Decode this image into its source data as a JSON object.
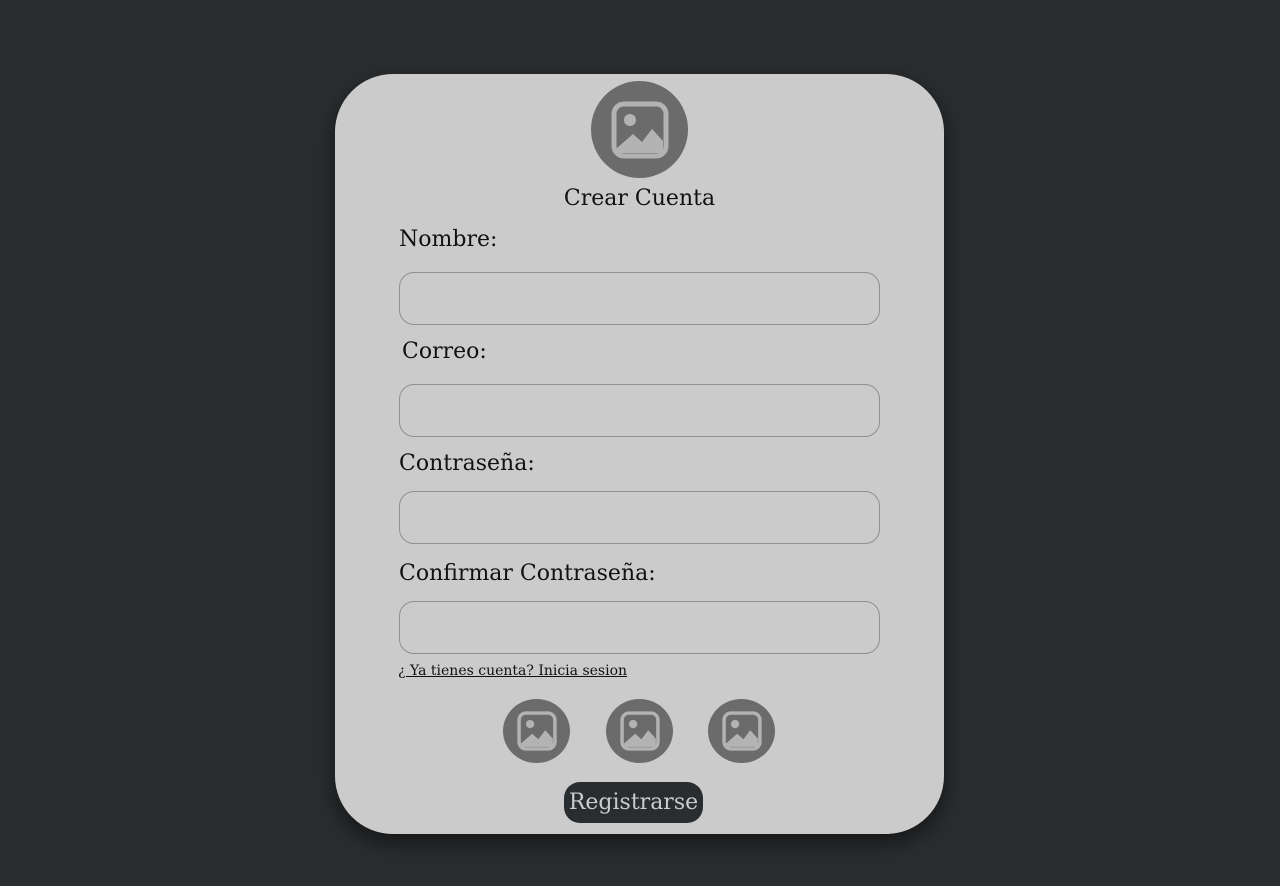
{
  "form": {
    "title": "Crear Cuenta",
    "fields": [
      {
        "label": "Nombre:",
        "value": "",
        "placeholder": ""
      },
      {
        "label": "Correo:",
        "value": "",
        "placeholder": ""
      },
      {
        "label": "Contraseña:",
        "value": "",
        "placeholder": ""
      },
      {
        "label": "Confirmar Contraseña:",
        "value": "",
        "placeholder": ""
      }
    ],
    "login_link": "¿ Ya tienes cuenta? Inicia sesion",
    "register_label": "Registrarse",
    "avatar_icon": "image-icon",
    "social_icons": [
      "image-icon",
      "image-icon",
      "image-icon"
    ]
  },
  "colors": {
    "background": "#2a2d2f",
    "card": "#cbcbcb",
    "icon_circle": "#6b6b6b",
    "button": "#2a2d2f"
  }
}
